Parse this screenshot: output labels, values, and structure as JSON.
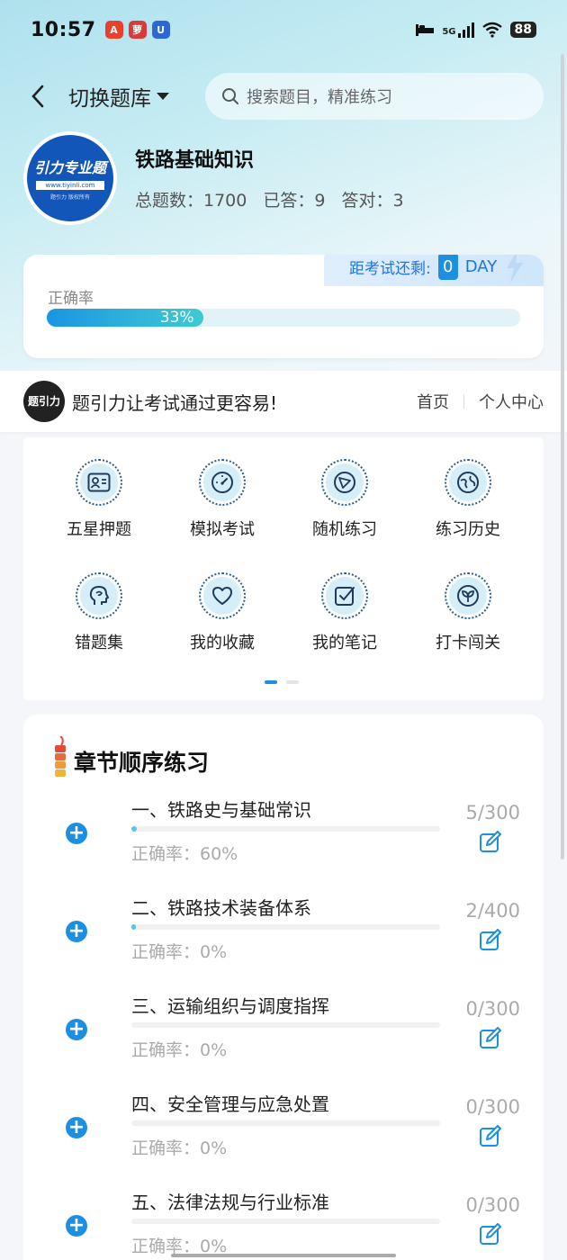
{
  "status_bar": {
    "time": "10:57",
    "battery": "88",
    "network": "5G",
    "app_badges": [
      {
        "label": "A",
        "color": "#e8402c"
      },
      {
        "label": "萝",
        "color": "#d93a3a"
      },
      {
        "label": "U",
        "color": "#2c67d6"
      }
    ]
  },
  "nav": {
    "back_icon": "chevron-left-icon",
    "switch_label": "切换题库",
    "search_placeholder": "搜索题目，精准练习"
  },
  "bank": {
    "logo_title": "引力专业题",
    "logo_url": "www.tiyinli.com",
    "logo_foot": "题引力 版权所有",
    "name": "铁路基础知识",
    "stats": {
      "total": "总题数：1700",
      "answered": "已答：9",
      "correct": "答对：3"
    }
  },
  "accuracy": {
    "label": "正确率",
    "percent_text": "33%",
    "percent": 33,
    "countdown_label": "距考试还剩:",
    "countdown_value": "0",
    "countdown_unit": "DAY"
  },
  "promo": {
    "logo_text": "题引力",
    "slogan": "题引力让考试通过更容易!",
    "links": [
      "首页",
      "个人中心"
    ]
  },
  "tools": [
    {
      "label": "五星押题",
      "icon": "id-card-icon"
    },
    {
      "label": "模拟考试",
      "icon": "gauge-icon"
    },
    {
      "label": "随机练习",
      "icon": "compass-icon"
    },
    {
      "label": "练习历史",
      "icon": "globe-icon"
    },
    {
      "label": "错题集",
      "icon": "head-icon"
    },
    {
      "label": "我的收藏",
      "icon": "heart-icon"
    },
    {
      "label": "我的笔记",
      "icon": "note-check-icon"
    },
    {
      "label": "打卡闯关",
      "icon": "sprout-icon"
    }
  ],
  "chapters_section": {
    "title": "章节顺序练习",
    "items": [
      {
        "title": "一、铁路史与基础常识",
        "accuracy": "正确率：60%",
        "count": "5/300",
        "progress": 0.0167
      },
      {
        "title": "二、铁路技术装备体系",
        "accuracy": "正确率：0%",
        "count": "2/400",
        "progress": 0.005
      },
      {
        "title": "三、运输组织与调度指挥",
        "accuracy": "正确率：0%",
        "count": "0/300",
        "progress": 0
      },
      {
        "title": "四、安全管理与应急处置",
        "accuracy": "正确率：0%",
        "count": "0/300",
        "progress": 0
      },
      {
        "title": "五、法律法规与行业标准",
        "accuracy": "正确率：0%",
        "count": "0/300",
        "progress": 0
      }
    ]
  },
  "colors": {
    "accent": "#1e8fe0",
    "progress_gradient_start": "#1a96e2",
    "progress_gradient_end": "#3fc9d3"
  }
}
